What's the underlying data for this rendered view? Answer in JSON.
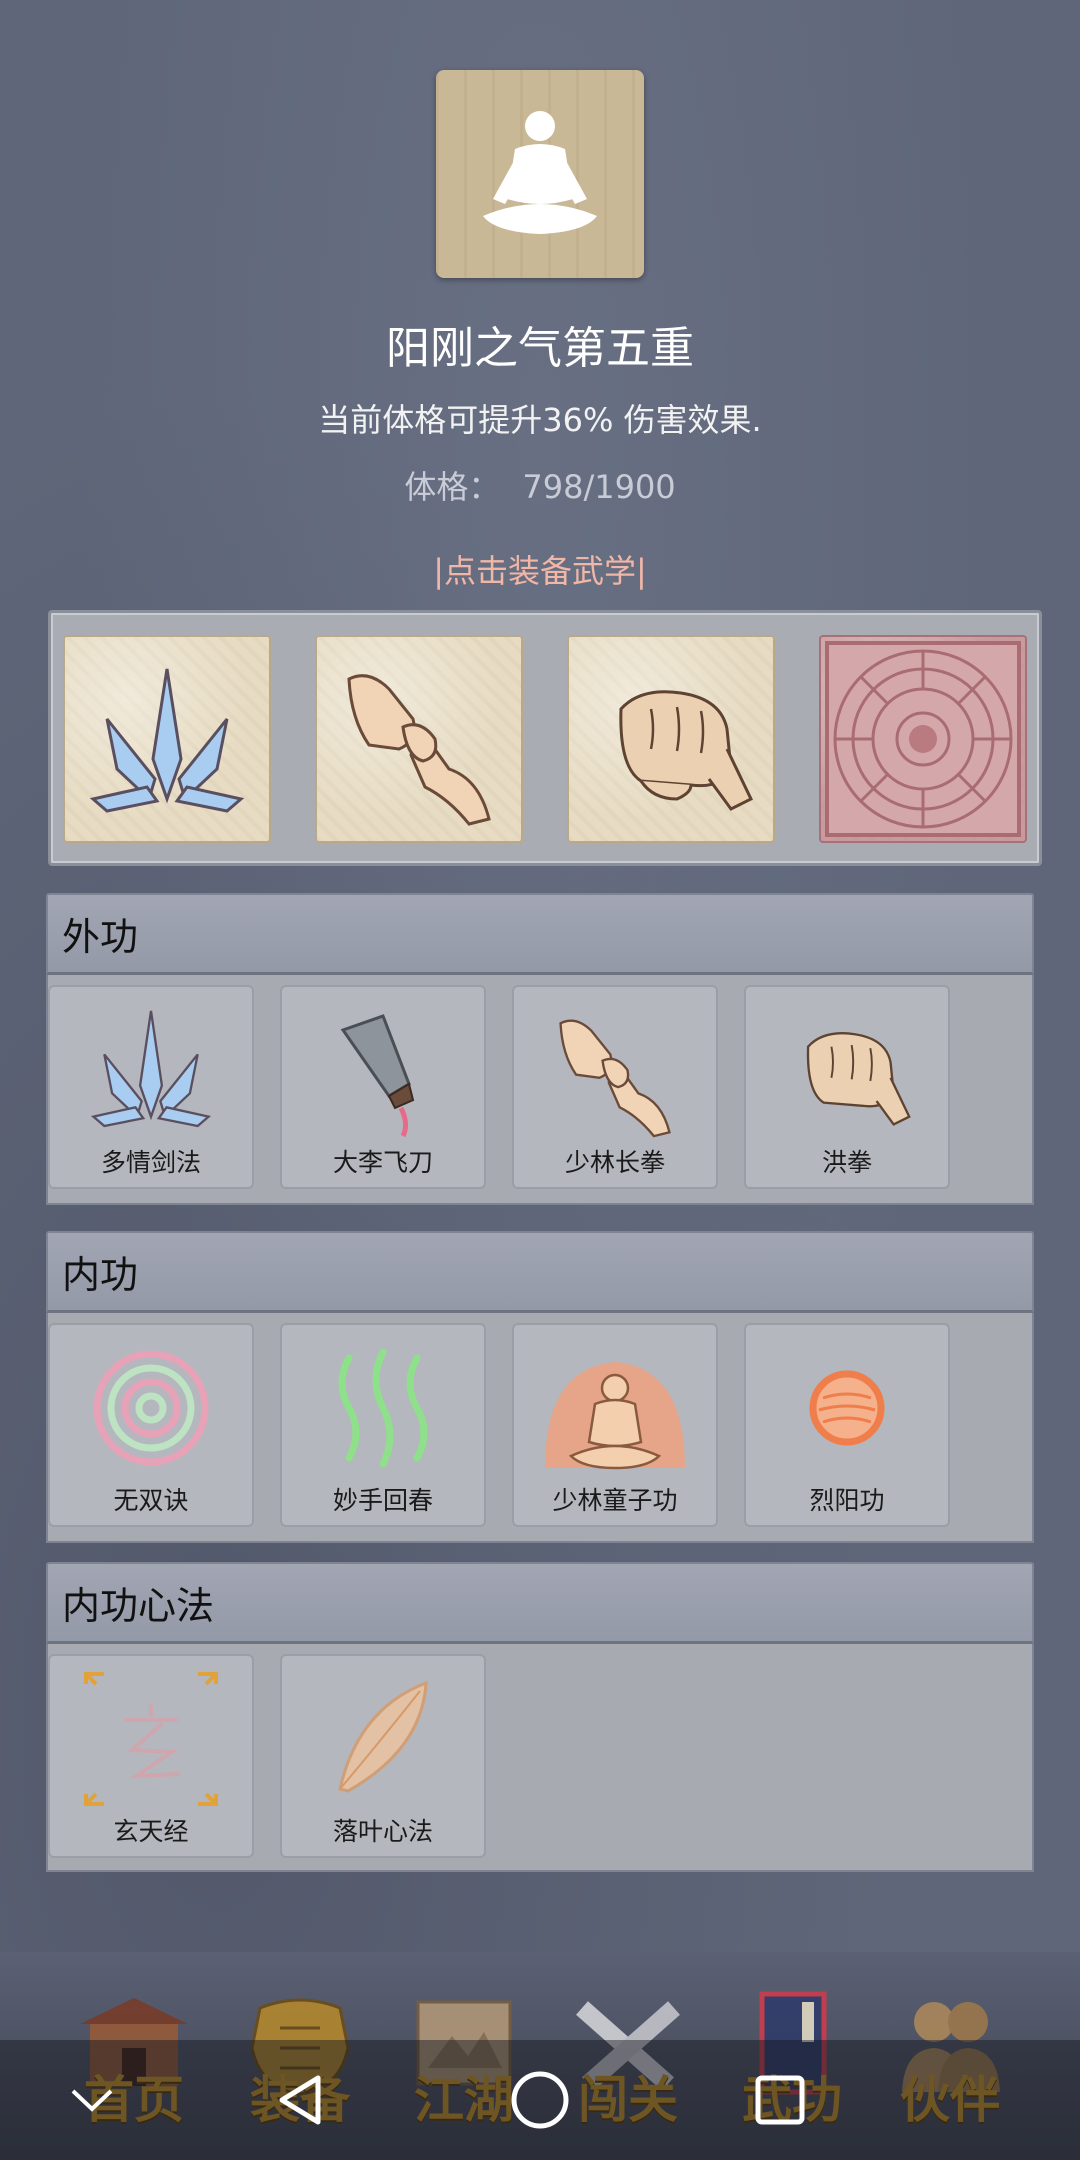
{
  "header": {
    "title": "阳刚之气第五重",
    "description": "当前体格可提升36% 伤害效果.",
    "stat_label": "体格：",
    "stat_value": "798/1900",
    "equip_hint": "|点击装备武学|"
  },
  "equipped": [
    {
      "icon": "crystal-sword-icon"
    },
    {
      "icon": "fist-bump-icon"
    },
    {
      "icon": "fist-icon"
    },
    {
      "icon": "aztec-sun-icon"
    }
  ],
  "sections": {
    "waigong": {
      "title": "外功",
      "items": [
        {
          "label": "多情剑法",
          "icon": "crystal-sword-icon"
        },
        {
          "label": "大李飞刀",
          "icon": "flying-knife-icon"
        },
        {
          "label": "少林长拳",
          "icon": "fist-bump-icon"
        },
        {
          "label": "洪拳",
          "icon": "fist-icon"
        }
      ]
    },
    "neigong": {
      "title": "内功",
      "items": [
        {
          "label": "无双诀",
          "icon": "spiral-icon"
        },
        {
          "label": "妙手回春",
          "icon": "green-waves-icon"
        },
        {
          "label": "少林童子功",
          "icon": "meditating-monk-icon"
        },
        {
          "label": "烈阳功",
          "icon": "sun-orb-icon"
        }
      ]
    },
    "xinfa": {
      "title": "内功心法",
      "items": [
        {
          "label": "玄天经",
          "icon": "xuan-seal-icon"
        },
        {
          "label": "落叶心法",
          "icon": "leaf-icon"
        }
      ]
    }
  },
  "tabs": [
    {
      "label": "首页",
      "icon": "temple-icon"
    },
    {
      "label": "装备",
      "icon": "armor-icon"
    },
    {
      "label": "江湖",
      "icon": "scroll-map-icon"
    },
    {
      "label": "闯关",
      "icon": "crossed-swords-icon"
    },
    {
      "label": "武功",
      "icon": "book-icon"
    },
    {
      "label": "伙伴",
      "icon": "partners-icon"
    }
  ],
  "colors": {
    "background": "#5f6679",
    "hint": "#f0b6a6",
    "tab_label": "#b88a2a"
  }
}
